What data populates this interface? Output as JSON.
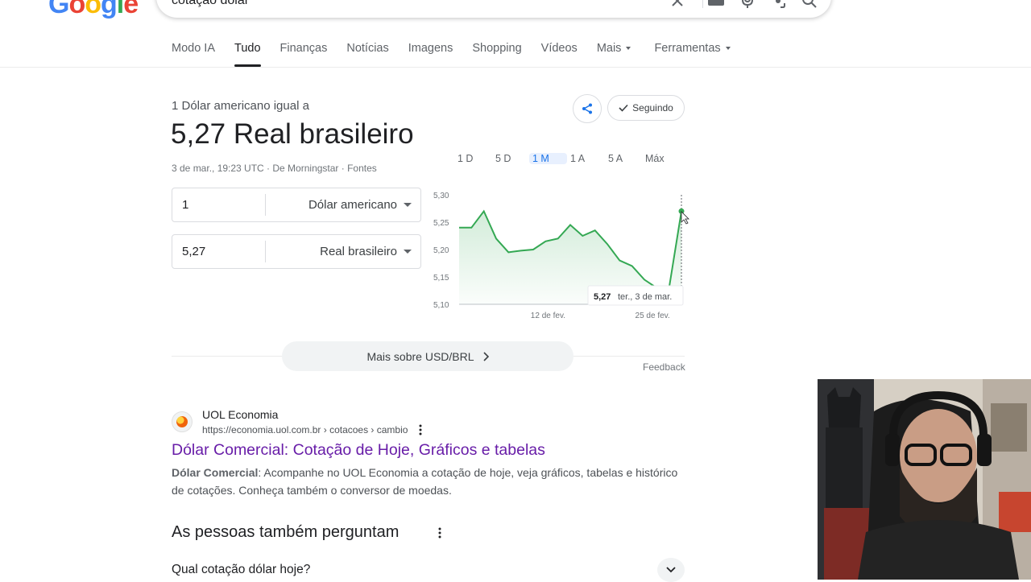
{
  "header": {
    "logo_letters": [
      "G",
      "o",
      "o",
      "g",
      "l",
      "e"
    ],
    "search_query": "cotação dólar",
    "icons": [
      "close-icon",
      "keyboard-icon",
      "mic-icon",
      "lens-icon",
      "search-icon"
    ]
  },
  "tabs": [
    {
      "label": "Modo IA",
      "active": false,
      "dropdown": false
    },
    {
      "label": "Tudo",
      "active": true,
      "dropdown": false
    },
    {
      "label": "Finanças",
      "active": false,
      "dropdown": false
    },
    {
      "label": "Notícias",
      "active": false,
      "dropdown": false
    },
    {
      "label": "Imagens",
      "active": false,
      "dropdown": false
    },
    {
      "label": "Shopping",
      "active": false,
      "dropdown": false
    },
    {
      "label": "Vídeos",
      "active": false,
      "dropdown": false
    },
    {
      "label": "Mais",
      "active": false,
      "dropdown": true
    }
  ],
  "tools_label": "Ferramentas",
  "currency": {
    "label": "1 Dólar americano igual a",
    "value": "5,27 Real brasileiro",
    "timestamp": "3 de mar., 19:23 UTC · De Morningstar · Fontes",
    "follow_label": "Seguindo",
    "from_amount": "1",
    "from_currency": "Dólar americano",
    "to_amount": "5,27",
    "to_currency": "Real brasileiro",
    "ranges": [
      {
        "label": "1 D",
        "active": false
      },
      {
        "label": "5 D",
        "active": false
      },
      {
        "label": "1 M",
        "active": true
      },
      {
        "label": "1 A",
        "active": false
      },
      {
        "label": "5 A",
        "active": false
      },
      {
        "label": "Máx",
        "active": false
      }
    ],
    "more_label": "Mais sobre USD/BRL",
    "feedback_label": "Feedback"
  },
  "chart_data": {
    "type": "area",
    "series": [
      {
        "values": [
          5.24,
          5.24,
          5.27,
          5.22,
          5.195,
          5.198,
          5.2,
          5.215,
          5.22,
          5.245,
          5.225,
          5.235,
          5.21,
          5.18,
          5.17,
          5.145,
          5.13,
          5.13,
          5.27
        ]
      }
    ],
    "y_ticks": [
      "5,30",
      "5,25",
      "5,20",
      "5,15",
      "5,10"
    ],
    "ylim": [
      5.1,
      5.3
    ],
    "x_tick_labels": [
      "12 de fev.",
      "25 de fev."
    ],
    "line_color": "#34a853",
    "tooltip": {
      "value": "5,27",
      "date": "ter., 3 de mar."
    }
  },
  "result": {
    "site_name": "UOL Economia",
    "url": "https://economia.uol.com.br › cotacoes › cambio",
    "title": "Dólar Comercial: Cotação de Hoje, Gráficos e tabelas",
    "snippet_bold": "Dólar Comercial",
    "snippet": ": Acompanhe no UOL Economia a cotação de hoje, veja gráficos, tabelas e histórico de cotações. Conheça também o conversor de moedas."
  },
  "people_also_ask": {
    "title": "As pessoas também perguntam",
    "question": "Qual cotação dólar hoje?"
  }
}
